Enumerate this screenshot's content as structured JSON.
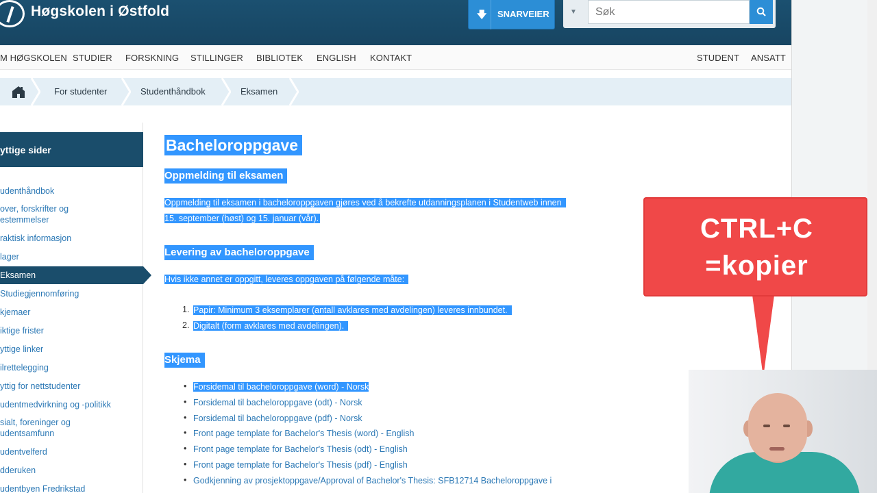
{
  "header": {
    "logo_text": "Høgskolen i Østfold",
    "shortcuts_label": "SNARVEIER",
    "search_placeholder": "Søk"
  },
  "nav": {
    "left": [
      "M HØGSKOLEN",
      "STUDIER",
      "FORSKNING",
      "STILLINGER",
      "BIBLIOTEK",
      "ENGLISH",
      "KONTAKT"
    ],
    "right": [
      "STUDENT",
      "ANSATT"
    ]
  },
  "breadcrumb": [
    "For studenter",
    "Studenthåndbok",
    "Eksamen"
  ],
  "sidebar": {
    "title": "yttige sider",
    "items": [
      "udenthåndbok",
      "over, forskrifter og",
      "estemmelser",
      "raktisk informasjon",
      "lager",
      "Eksamen",
      "Studiegjennomføring",
      "kjemaer",
      "iktige frister",
      "yttige linker",
      "ilrettelegging",
      "yttig for nettstudenter",
      "udentmedvirkning og -politikk",
      "sialt, foreninger og",
      "udentsamfunn",
      "udentvelferd",
      "dderuken",
      "udentbyen Fredrikstad"
    ]
  },
  "content": {
    "title": "Bacheloroppgave",
    "section1_heading": "Oppmelding til eksamen",
    "section1_line1": "Oppmelding til eksamen i bacheloroppgaven gjøres ved å bekrefte utdanningsplanen i Studentweb innen",
    "section1_line2": "15. september (høst) og 15. januar (vår).",
    "section2_heading": "Levering av bacheloroppgave",
    "section2_text": "Hvis ikke annet er oppgitt, leveres oppgaven på følgende måte:",
    "ordered": [
      "Papir: Minimum 3 eksemplarer (antall avklares med avdelingen) leveres innbundet.",
      "Digitalt (form avklares med avdelingen)."
    ],
    "ordered_markers": [
      "1.",
      "2."
    ],
    "section3_heading": "Skjema",
    "forms": [
      "Forsidemal til bacheloroppgave (word) - Norsk",
      "Forsidemal til bacheloroppgave (odt) - Norsk",
      "Forsidemal til bacheloroppgave (pdf) - Norsk",
      "Front page template for Bachelor's Thesis (word) - English",
      "Front page template for Bachelor's Thesis (odt) - English",
      "Front page template for Bachelor's Thesis (pdf) - English",
      "Godkjenning av prosjektoppgave/Approval of Bachelor's Thesis: SFB12714 Bacheloroppgave i"
    ]
  },
  "callout": {
    "line1": "CTRL+C",
    "line2": "=kopier"
  },
  "colors": {
    "header_bg": "#1a4d6b",
    "accent_blue": "#2c8ed6",
    "selection": "#3296ff",
    "link": "#2b78b5",
    "callout_red": "#f04848"
  }
}
